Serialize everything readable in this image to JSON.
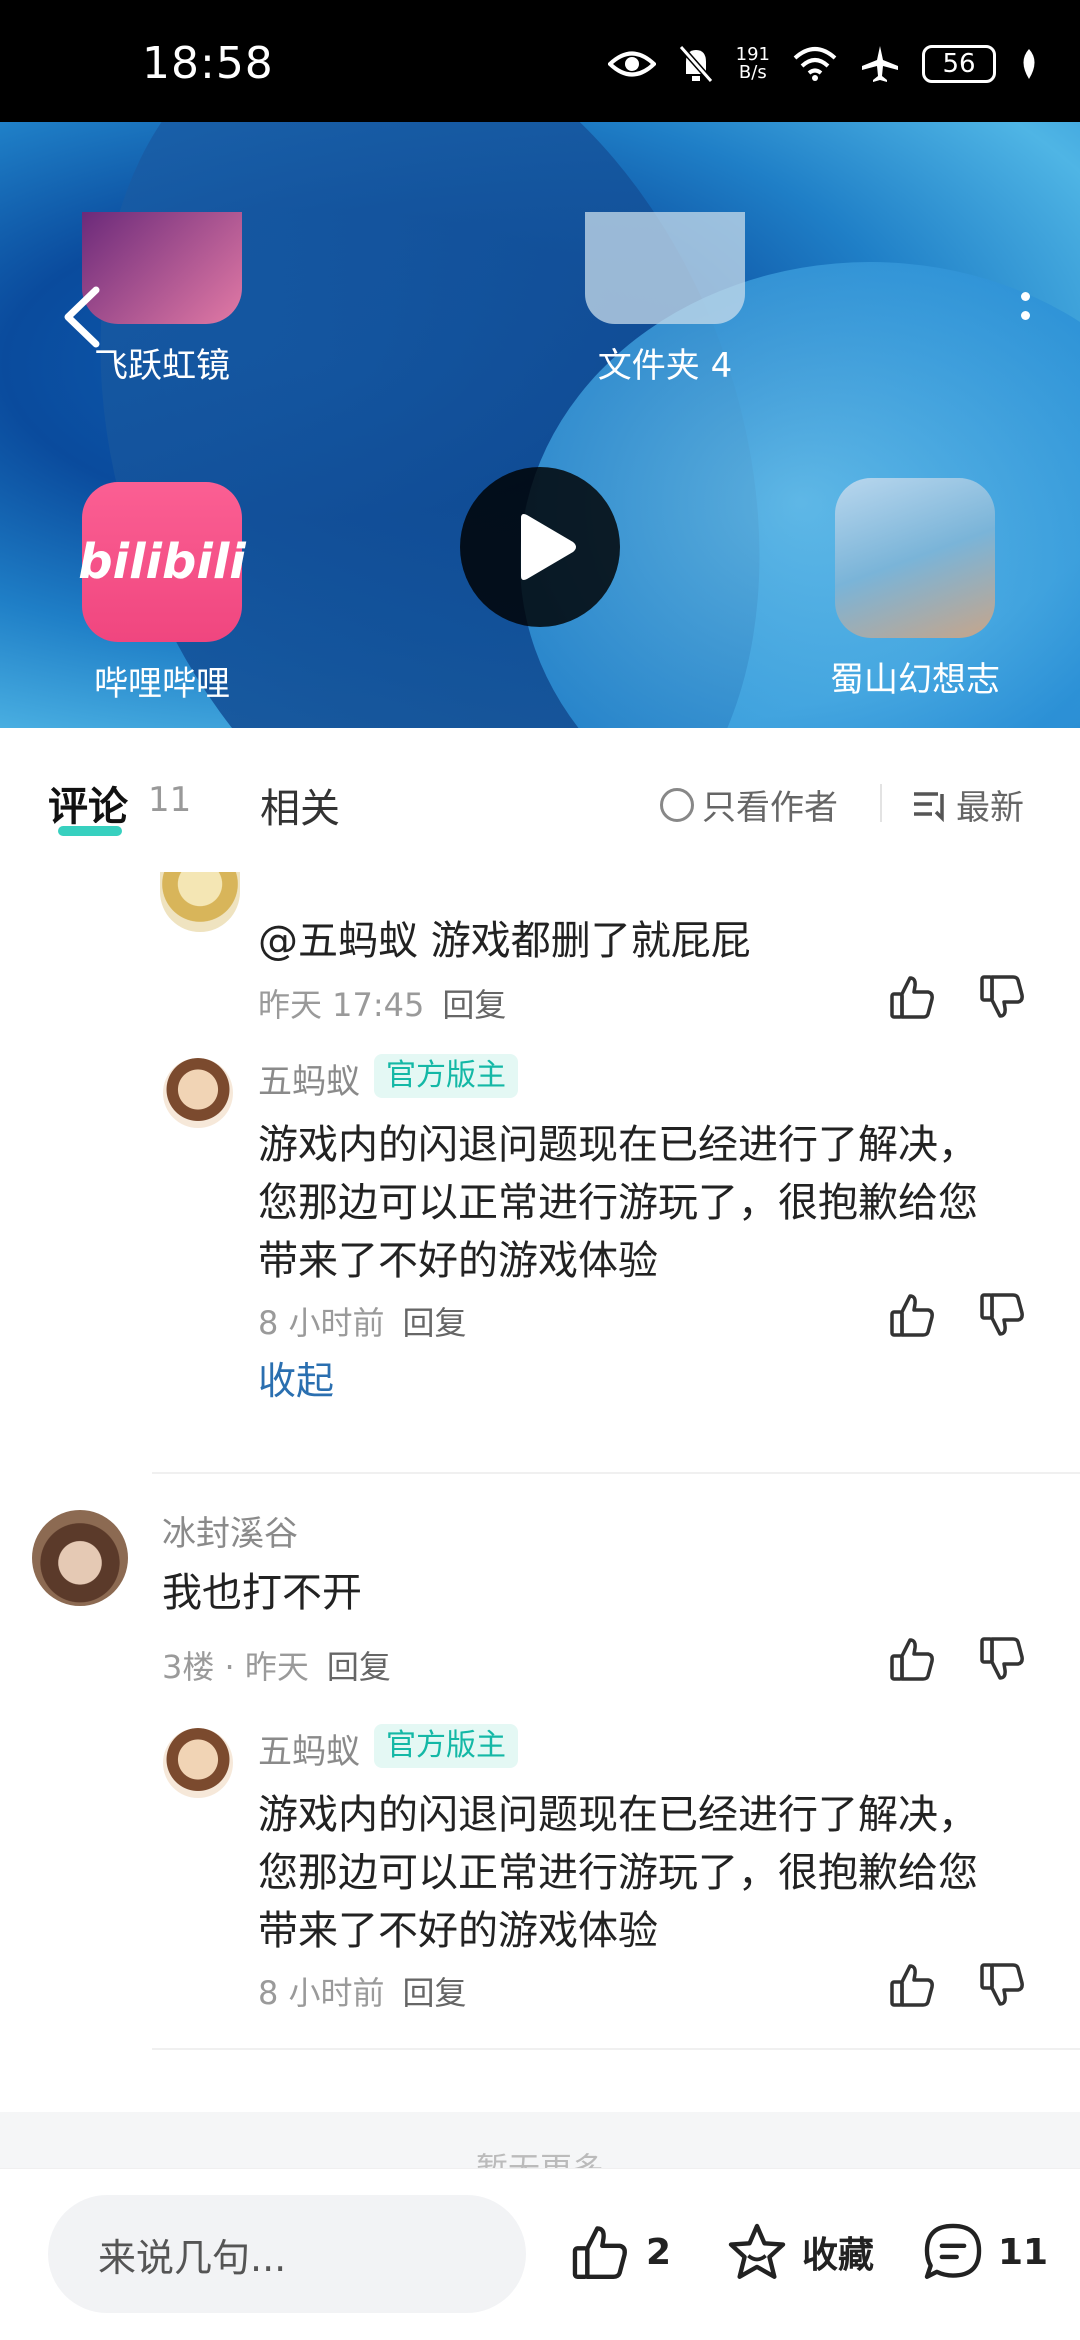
{
  "status": {
    "time": "18:58",
    "net_speed_top": "191",
    "net_speed_bottom": "B/s",
    "battery": "56"
  },
  "video": {
    "apps": [
      {
        "label": "飞跃虹镜"
      },
      {
        "label": "文件夹 4"
      },
      {
        "label": "哔哩哔哩",
        "icon_text": "bilibili"
      },
      {
        "label": "蜀山幻想志"
      }
    ]
  },
  "tabs": {
    "comments_label": "评论",
    "comments_count": "11",
    "related_label": "相关",
    "author_only_label": "只看作者",
    "sort_label": "最新"
  },
  "comments": {
    "top_reply": {
      "text": "@五蚂蚁  游戏都删了就屁屁",
      "time": "昨天 17:45",
      "reply": "回复"
    },
    "reply1": {
      "author": "五蚂蚁",
      "badge": "官方版主",
      "lines": [
        "游戏内的闪退问题现在已经进行了解决，",
        "您那边可以正常进行游玩了，很抱歉给您",
        "带来了不好的游戏体验"
      ],
      "time": "8 小时前",
      "reply": "回复"
    },
    "collapse": "收起",
    "comment2": {
      "author": "冰封溪谷",
      "text": "我也打不开",
      "meta": "3楼 · 昨天",
      "reply": "回复"
    },
    "reply2": {
      "author": "五蚂蚁",
      "badge": "官方版主",
      "lines": [
        "游戏内的闪退问题现在已经进行了解决，",
        "您那边可以正常进行游玩了，很抱歉给您",
        "带来了不好的游戏体验"
      ],
      "time": "8 小时前",
      "reply": "回复"
    },
    "no_more": "暂无更多"
  },
  "bottom_bar": {
    "input_placeholder": "来说几句...",
    "like_count": "2",
    "favorite_label": "收藏",
    "comment_count": "11"
  }
}
